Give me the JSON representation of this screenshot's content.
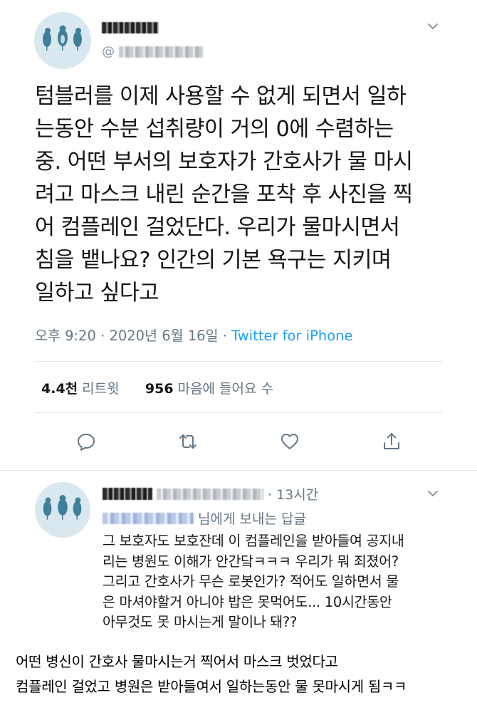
{
  "main_tweet": {
    "avatar_icon": "birds-avatar-icon",
    "text": "텀블러를 이제 사용할 수 없게 되면서 일하\n는동안 수분 섭취량이 거의 0에 수렴하는\n중. 어떤 부서의 보호자가 간호사가 물 마시\n려고 마스크 내린 순간을 포착 후 사진을 찍\n어 컴플레인 걸었단다. 우리가 물마시면서\n침을 뱉나요? 인간의 기본 욕구는 지키며\n일하고 싶다고",
    "timestamp": "오후 9:20 · 2020년 6월 16일 · ",
    "source": "Twitter for iPhone",
    "retweets_count": "4.4천",
    "retweets_label": " 리트윗",
    "likes_count": "956",
    "likes_label": " 마음에 들어요 수"
  },
  "actions": [
    "reply-icon",
    "retweet-icon",
    "like-icon",
    "share-icon"
  ],
  "reply_tweet": {
    "time": "· 13시간",
    "reply_to_suffix": " 님에게 보내는 답글",
    "text": "그 보호자도 보호잔데 이 컴플레인을 받아들여 공지내\n리는 병원도 이해가 안간닼ㅋㅋㅋ 우리가 뭐 죄졌어?\n그리고 간호사가 무슨 로봇인가? 적어도 일하면서 물\n은 마셔야할거 아니야 밥은 못먹어도... 10시간동안\n아무것도 못 마시는게 말이나 돼??"
  },
  "caption": "어떤 병신이 간호사 물마시는거 찍어서 마스크 벗었다고\n컴플레인 걸었고 병원은 받아들여서 일하는동안 물 못마시게 됨ㅋㅋ",
  "colors": {
    "accent": "#1da1f2",
    "muted": "#657786",
    "divider": "#e1e8ed"
  }
}
